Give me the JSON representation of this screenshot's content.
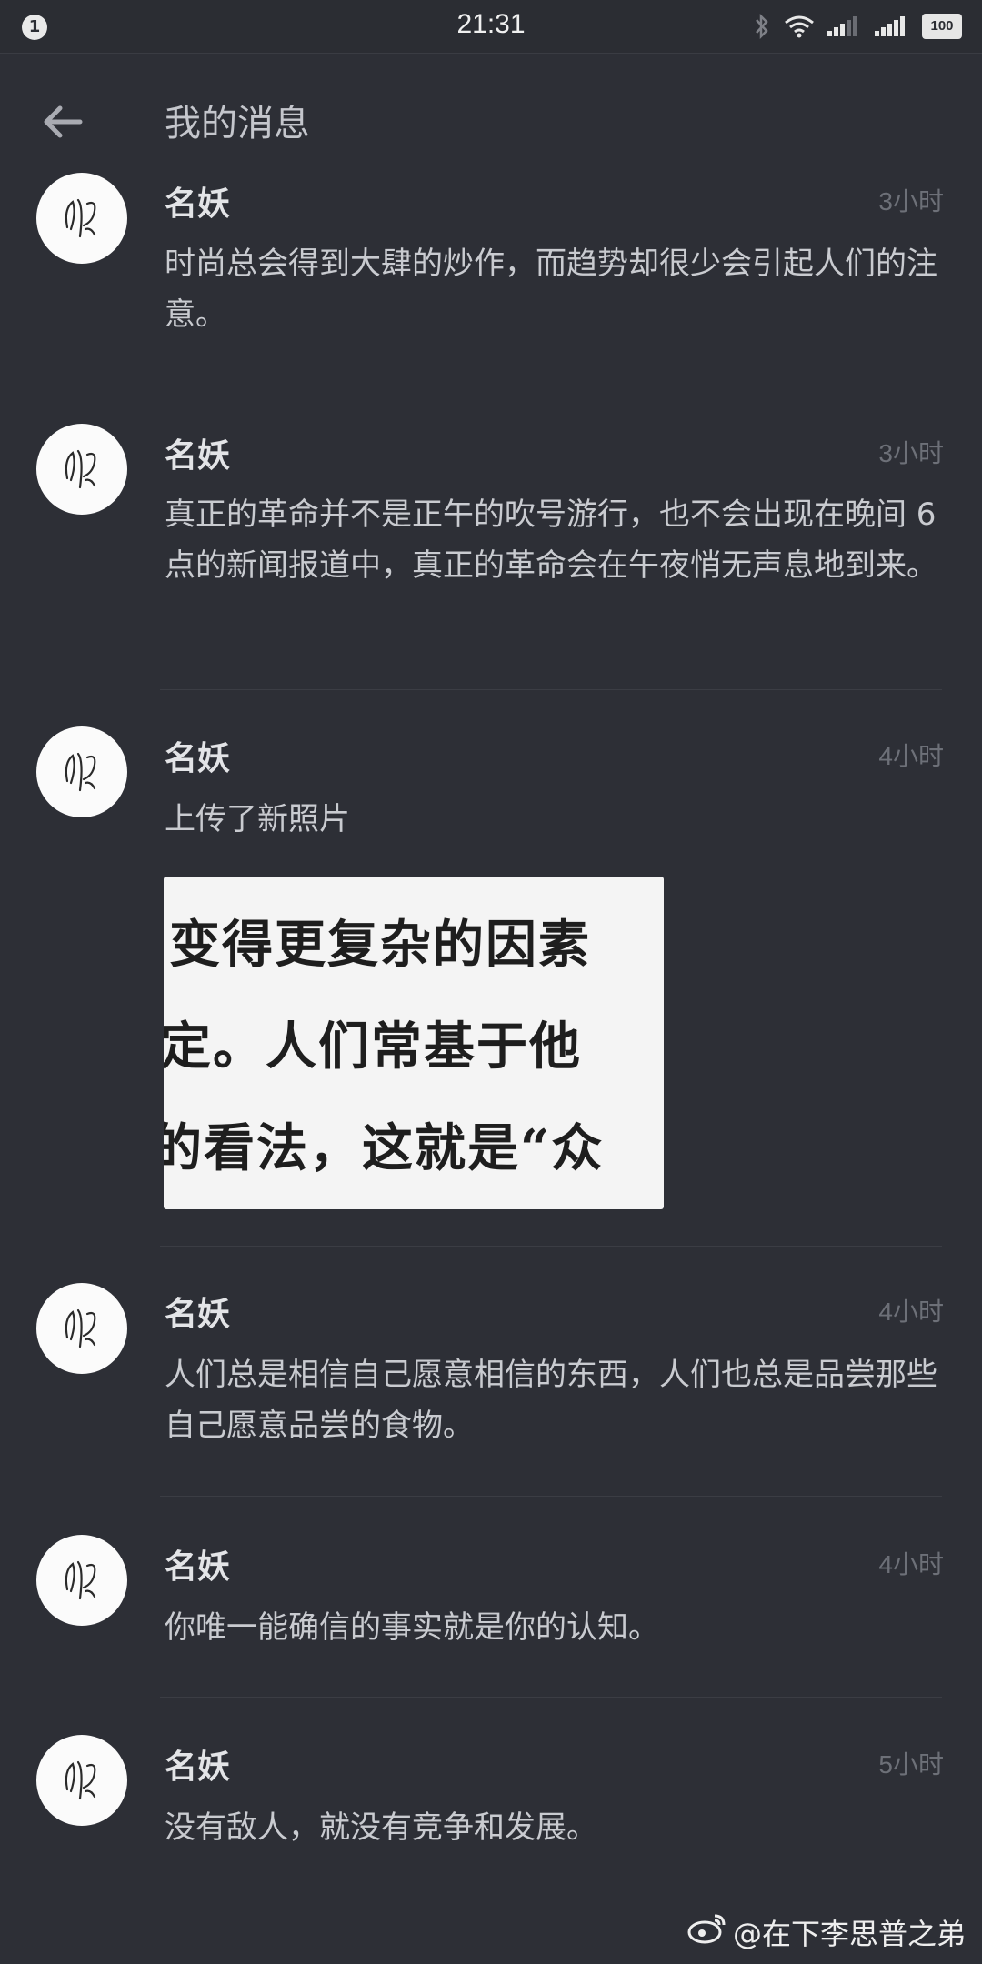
{
  "status_bar": {
    "notification_count": "1",
    "time": "21:31",
    "battery": "100"
  },
  "header": {
    "title": "我的消息"
  },
  "messages": [
    {
      "sender": "名妖",
      "time": "3小时",
      "text": "时尚总会得到大肆的炒作，而趋势却很少会引起人们的注意。"
    },
    {
      "sender": "名妖",
      "time": "3小时",
      "text": "真正的革命并不是正午的吹号游行，也不会出现在晚间 6 点的新闻报道中，真正的革命会在午夜悄无声息地到来。"
    },
    {
      "sender": "名妖",
      "time": "4小时",
      "text": "上传了新照片",
      "photo_lines": [
        "变得更复杂的因素",
        "定。人们常基于他",
        "的看法，这就是“众"
      ]
    },
    {
      "sender": "名妖",
      "time": "4小时",
      "text": "人们总是相信自己愿意相信的东西，人们也总是品尝那些自己愿意品尝的食物。"
    },
    {
      "sender": "名妖",
      "time": "4小时",
      "text": "你唯一能确信的事实就是你的认知。"
    },
    {
      "sender": "名妖",
      "time": "5小时",
      "text": "没有敌人，就没有竞争和发展。"
    }
  ],
  "watermark": "@在下李思普之弟",
  "colors": {
    "background": "#2d2f36",
    "avatar_bg": "#fbfbfb",
    "time_text": "#6d7078"
  },
  "icons": [
    "back-arrow-icon",
    "bluetooth-icon",
    "wifi-icon",
    "signal-icon",
    "battery-icon",
    "weibo-icon"
  ]
}
